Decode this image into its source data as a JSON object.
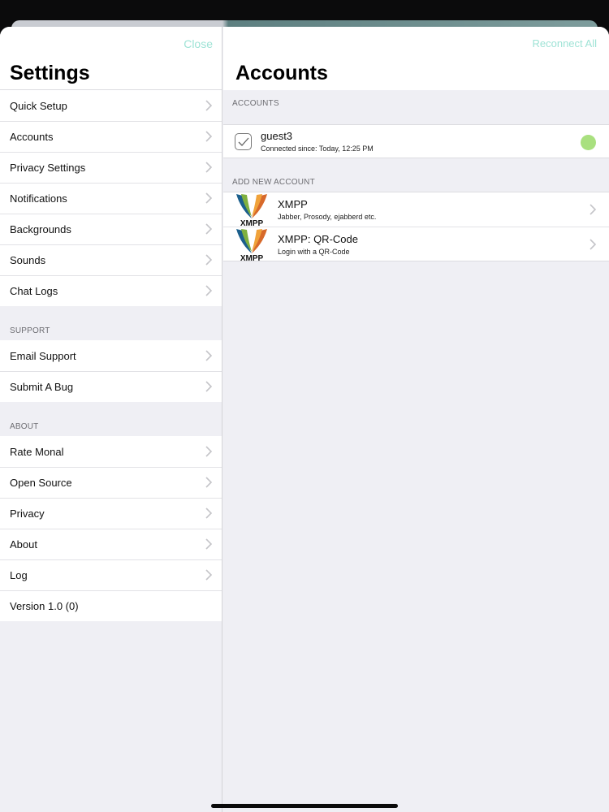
{
  "settings": {
    "close_label": "Close",
    "title": "Settings",
    "main_items": [
      {
        "label": "Quick Setup"
      },
      {
        "label": "Accounts"
      },
      {
        "label": "Privacy Settings"
      },
      {
        "label": "Notifications"
      },
      {
        "label": "Backgrounds"
      },
      {
        "label": "Sounds"
      },
      {
        "label": "Chat Logs"
      }
    ],
    "support_header": "SUPPORT",
    "support_items": [
      {
        "label": "Email Support"
      },
      {
        "label": "Submit A Bug"
      }
    ],
    "about_header": "ABOUT",
    "about_items": [
      {
        "label": "Rate Monal"
      },
      {
        "label": "Open Source"
      },
      {
        "label": "Privacy"
      },
      {
        "label": "About"
      },
      {
        "label": "Log"
      }
    ],
    "version_label": "Version 1.0 (0)"
  },
  "accounts": {
    "reconnect_label": "Reconnect All",
    "title": "Accounts",
    "section_header": "ACCOUNTS",
    "account": {
      "name": "guest3",
      "status_text": "Connected since: Today, 12:25 PM",
      "status_color": "#a9e07f"
    },
    "add_header": "ADD NEW ACCOUNT",
    "add_options": [
      {
        "title": "XMPP",
        "subtitle": "Jabber, Prosody, ejabberd etc.",
        "logo_text": "XMPP"
      },
      {
        "title": "XMPP: QR-Code",
        "subtitle": "Login with a QR-Code",
        "logo_text": "XMPP"
      }
    ]
  },
  "colors": {
    "accent": "#9fe3d6",
    "background": "#efeff4",
    "online": "#a9e07f"
  }
}
